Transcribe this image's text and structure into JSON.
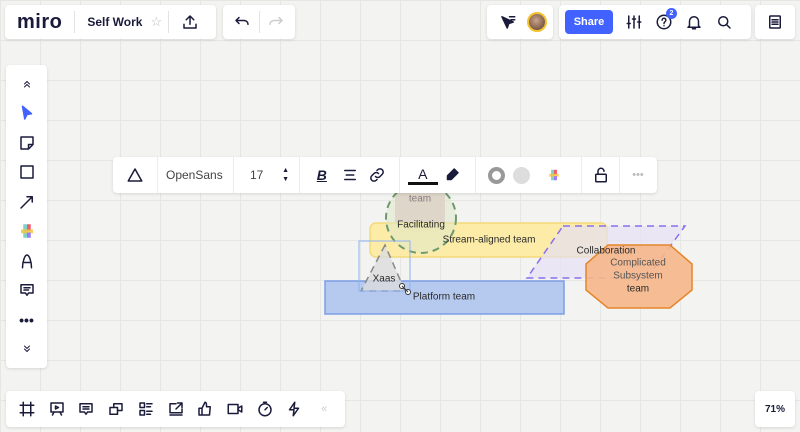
{
  "header": {
    "logo": "miro",
    "board_title": "Self Work",
    "share_label": "Share",
    "help_badge": "2"
  },
  "context_toolbar": {
    "font": "OpenSans",
    "font_size": "17"
  },
  "canvas": {
    "shapes": [
      {
        "label": "team"
      },
      {
        "label": "Facilitating"
      },
      {
        "label": "Stream-aligned team"
      },
      {
        "label": "Collaboration"
      },
      {
        "label": "Complicated"
      },
      {
        "label": "Subsystem"
      },
      {
        "label": "team"
      },
      {
        "label": "Platform team"
      },
      {
        "label": "Xaas"
      }
    ]
  },
  "zoom": {
    "level": "71%"
  },
  "colors": {
    "accent": "#4262ff",
    "yellow": "#fdeca1",
    "blue": "#b6c9ee",
    "orange": "#f6b689",
    "pink": "#d8b9c2"
  }
}
